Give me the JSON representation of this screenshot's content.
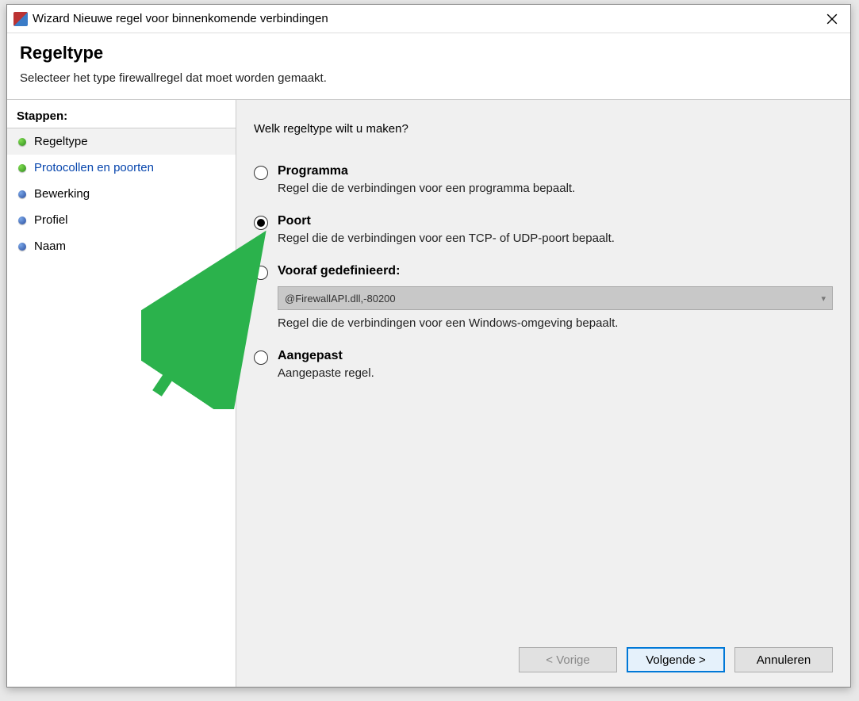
{
  "window": {
    "title": "Wizard Nieuwe regel voor binnenkomende verbindingen"
  },
  "header": {
    "title": "Regeltype",
    "subtitle": "Selecteer het type firewallregel dat moet worden gemaakt."
  },
  "sidebar": {
    "steps_label": "Stappen:",
    "items": [
      {
        "label": "Regeltype",
        "bullet": "green",
        "link": false,
        "current": true
      },
      {
        "label": "Protocollen en poorten",
        "bullet": "green",
        "link": true,
        "current": false
      },
      {
        "label": "Bewerking",
        "bullet": "blue",
        "link": false,
        "current": false
      },
      {
        "label": "Profiel",
        "bullet": "blue",
        "link": false,
        "current": false
      },
      {
        "label": "Naam",
        "bullet": "blue",
        "link": false,
        "current": false
      }
    ]
  },
  "content": {
    "question": "Welk regeltype wilt u maken?",
    "options": [
      {
        "id": "programma",
        "title": "Programma",
        "desc": "Regel die de verbindingen voor een programma bepaalt.",
        "selected": false
      },
      {
        "id": "poort",
        "title": "Poort",
        "desc": "Regel die de verbindingen voor een TCP- of UDP-poort bepaalt.",
        "selected": true
      },
      {
        "id": "voorafgedefinieerd",
        "title": "Vooraf gedefinieerd:",
        "dropdown_value": "@FirewallAPI.dll,-80200",
        "desc": "Regel die de verbindingen voor een Windows-omgeving bepaalt.",
        "selected": false
      },
      {
        "id": "aangepast",
        "title": "Aangepast",
        "desc": "Aangepaste regel.",
        "selected": false
      }
    ]
  },
  "buttons": {
    "back": "< Vorige",
    "next": "Volgende >",
    "cancel": "Annuleren"
  }
}
